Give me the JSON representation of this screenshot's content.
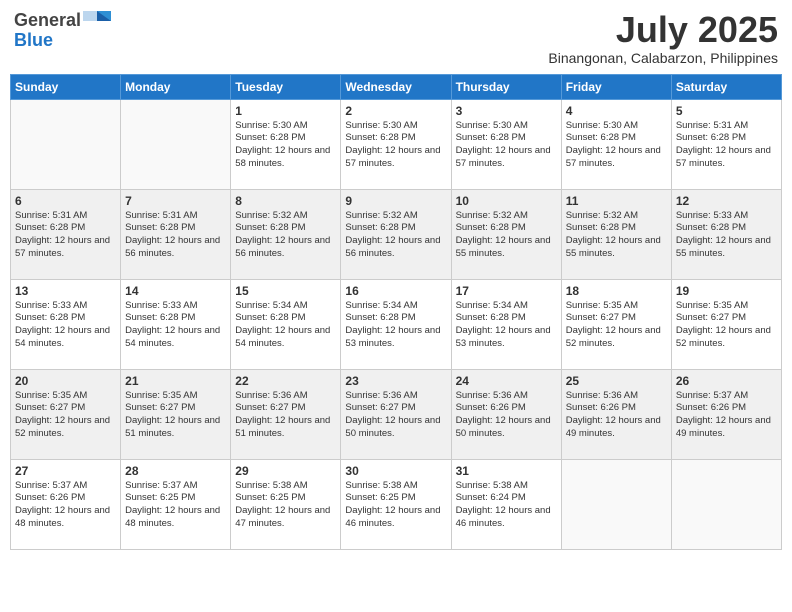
{
  "logo": {
    "general": "General",
    "blue": "Blue"
  },
  "title": {
    "month_year": "July 2025",
    "location": "Binangonan, Calabarzon, Philippines"
  },
  "headers": [
    "Sunday",
    "Monday",
    "Tuesday",
    "Wednesday",
    "Thursday",
    "Friday",
    "Saturday"
  ],
  "weeks": [
    [
      {
        "day": "",
        "sunrise": "",
        "sunset": "",
        "daylight": ""
      },
      {
        "day": "",
        "sunrise": "",
        "sunset": "",
        "daylight": ""
      },
      {
        "day": "1",
        "sunrise": "Sunrise: 5:30 AM",
        "sunset": "Sunset: 6:28 PM",
        "daylight": "Daylight: 12 hours and 58 minutes."
      },
      {
        "day": "2",
        "sunrise": "Sunrise: 5:30 AM",
        "sunset": "Sunset: 6:28 PM",
        "daylight": "Daylight: 12 hours and 57 minutes."
      },
      {
        "day": "3",
        "sunrise": "Sunrise: 5:30 AM",
        "sunset": "Sunset: 6:28 PM",
        "daylight": "Daylight: 12 hours and 57 minutes."
      },
      {
        "day": "4",
        "sunrise": "Sunrise: 5:30 AM",
        "sunset": "Sunset: 6:28 PM",
        "daylight": "Daylight: 12 hours and 57 minutes."
      },
      {
        "day": "5",
        "sunrise": "Sunrise: 5:31 AM",
        "sunset": "Sunset: 6:28 PM",
        "daylight": "Daylight: 12 hours and 57 minutes."
      }
    ],
    [
      {
        "day": "6",
        "sunrise": "Sunrise: 5:31 AM",
        "sunset": "Sunset: 6:28 PM",
        "daylight": "Daylight: 12 hours and 57 minutes."
      },
      {
        "day": "7",
        "sunrise": "Sunrise: 5:31 AM",
        "sunset": "Sunset: 6:28 PM",
        "daylight": "Daylight: 12 hours and 56 minutes."
      },
      {
        "day": "8",
        "sunrise": "Sunrise: 5:32 AM",
        "sunset": "Sunset: 6:28 PM",
        "daylight": "Daylight: 12 hours and 56 minutes."
      },
      {
        "day": "9",
        "sunrise": "Sunrise: 5:32 AM",
        "sunset": "Sunset: 6:28 PM",
        "daylight": "Daylight: 12 hours and 56 minutes."
      },
      {
        "day": "10",
        "sunrise": "Sunrise: 5:32 AM",
        "sunset": "Sunset: 6:28 PM",
        "daylight": "Daylight: 12 hours and 55 minutes."
      },
      {
        "day": "11",
        "sunrise": "Sunrise: 5:32 AM",
        "sunset": "Sunset: 6:28 PM",
        "daylight": "Daylight: 12 hours and 55 minutes."
      },
      {
        "day": "12",
        "sunrise": "Sunrise: 5:33 AM",
        "sunset": "Sunset: 6:28 PM",
        "daylight": "Daylight: 12 hours and 55 minutes."
      }
    ],
    [
      {
        "day": "13",
        "sunrise": "Sunrise: 5:33 AM",
        "sunset": "Sunset: 6:28 PM",
        "daylight": "Daylight: 12 hours and 54 minutes."
      },
      {
        "day": "14",
        "sunrise": "Sunrise: 5:33 AM",
        "sunset": "Sunset: 6:28 PM",
        "daylight": "Daylight: 12 hours and 54 minutes."
      },
      {
        "day": "15",
        "sunrise": "Sunrise: 5:34 AM",
        "sunset": "Sunset: 6:28 PM",
        "daylight": "Daylight: 12 hours and 54 minutes."
      },
      {
        "day": "16",
        "sunrise": "Sunrise: 5:34 AM",
        "sunset": "Sunset: 6:28 PM",
        "daylight": "Daylight: 12 hours and 53 minutes."
      },
      {
        "day": "17",
        "sunrise": "Sunrise: 5:34 AM",
        "sunset": "Sunset: 6:28 PM",
        "daylight": "Daylight: 12 hours and 53 minutes."
      },
      {
        "day": "18",
        "sunrise": "Sunrise: 5:35 AM",
        "sunset": "Sunset: 6:27 PM",
        "daylight": "Daylight: 12 hours and 52 minutes."
      },
      {
        "day": "19",
        "sunrise": "Sunrise: 5:35 AM",
        "sunset": "Sunset: 6:27 PM",
        "daylight": "Daylight: 12 hours and 52 minutes."
      }
    ],
    [
      {
        "day": "20",
        "sunrise": "Sunrise: 5:35 AM",
        "sunset": "Sunset: 6:27 PM",
        "daylight": "Daylight: 12 hours and 52 minutes."
      },
      {
        "day": "21",
        "sunrise": "Sunrise: 5:35 AM",
        "sunset": "Sunset: 6:27 PM",
        "daylight": "Daylight: 12 hours and 51 minutes."
      },
      {
        "day": "22",
        "sunrise": "Sunrise: 5:36 AM",
        "sunset": "Sunset: 6:27 PM",
        "daylight": "Daylight: 12 hours and 51 minutes."
      },
      {
        "day": "23",
        "sunrise": "Sunrise: 5:36 AM",
        "sunset": "Sunset: 6:27 PM",
        "daylight": "Daylight: 12 hours and 50 minutes."
      },
      {
        "day": "24",
        "sunrise": "Sunrise: 5:36 AM",
        "sunset": "Sunset: 6:26 PM",
        "daylight": "Daylight: 12 hours and 50 minutes."
      },
      {
        "day": "25",
        "sunrise": "Sunrise: 5:36 AM",
        "sunset": "Sunset: 6:26 PM",
        "daylight": "Daylight: 12 hours and 49 minutes."
      },
      {
        "day": "26",
        "sunrise": "Sunrise: 5:37 AM",
        "sunset": "Sunset: 6:26 PM",
        "daylight": "Daylight: 12 hours and 49 minutes."
      }
    ],
    [
      {
        "day": "27",
        "sunrise": "Sunrise: 5:37 AM",
        "sunset": "Sunset: 6:26 PM",
        "daylight": "Daylight: 12 hours and 48 minutes."
      },
      {
        "day": "28",
        "sunrise": "Sunrise: 5:37 AM",
        "sunset": "Sunset: 6:25 PM",
        "daylight": "Daylight: 12 hours and 48 minutes."
      },
      {
        "day": "29",
        "sunrise": "Sunrise: 5:38 AM",
        "sunset": "Sunset: 6:25 PM",
        "daylight": "Daylight: 12 hours and 47 minutes."
      },
      {
        "day": "30",
        "sunrise": "Sunrise: 5:38 AM",
        "sunset": "Sunset: 6:25 PM",
        "daylight": "Daylight: 12 hours and 46 minutes."
      },
      {
        "day": "31",
        "sunrise": "Sunrise: 5:38 AM",
        "sunset": "Sunset: 6:24 PM",
        "daylight": "Daylight: 12 hours and 46 minutes."
      },
      {
        "day": "",
        "sunrise": "",
        "sunset": "",
        "daylight": ""
      },
      {
        "day": "",
        "sunrise": "",
        "sunset": "",
        "daylight": ""
      }
    ]
  ]
}
